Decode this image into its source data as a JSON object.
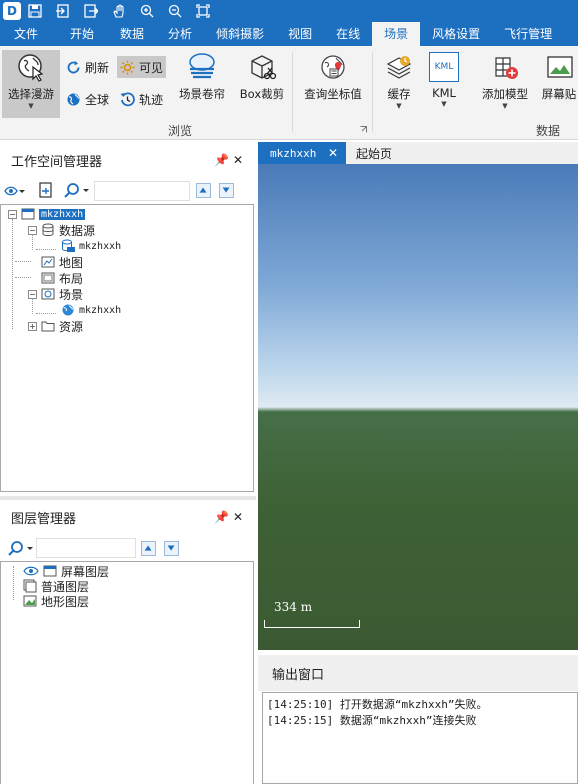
{
  "titlebar": {
    "logo_text": "D",
    "quick_access": [
      "save-icon",
      "import-icon",
      "export-icon",
      "pan-hand-icon",
      "zoom-in-icon",
      "zoom-out-icon",
      "full-extent-icon"
    ]
  },
  "menu": {
    "items": [
      "文件",
      "开始",
      "数据",
      "分析",
      "倾斜摄影",
      "视图",
      "在线",
      "场景",
      "风格设置",
      "飞行管理"
    ],
    "active_index": 7
  },
  "ribbon": {
    "browse": {
      "select_roam": "选择漫游",
      "refresh": "刷新",
      "visible": "可见",
      "globe": "全球",
      "track": "轨迹",
      "scene_curtain": "场景卷帘",
      "box_clip": "Box裁剪",
      "query_coords": "查询坐标值",
      "group_label": "浏览"
    },
    "data": {
      "cache": "缓存",
      "kml": "KML",
      "kml_icon_text": "KML",
      "add_model": "添加模型",
      "screen_paste": "屏幕贴",
      "group_label": "数据"
    }
  },
  "workspace": {
    "title": "工作空间管理器",
    "pin": "📌",
    "close": "✕",
    "tree": {
      "root": "mkzhxxh",
      "datasources": "数据源",
      "datasource_child": "mkzhxxh",
      "map": "地图",
      "layout": "布局",
      "scene": "场景",
      "scene_child": "mkzhxxh",
      "resources": "资源"
    }
  },
  "layers": {
    "title": "图层管理器",
    "pin": "📌",
    "close": "✕",
    "items": [
      "屏幕图层",
      "普通图层",
      "地形图层"
    ]
  },
  "document": {
    "tabs": [
      {
        "label": "mkzhxxh",
        "close": "✕"
      },
      {
        "label": "起始页"
      }
    ],
    "scale_text": "334  m"
  },
  "output": {
    "title": "输出窗口",
    "lines": [
      "[14:25:10] 打开数据源“mkzhxxh”失败。",
      "[14:25:15] 数据源“mkzhxxh”连接失败"
    ]
  },
  "colors": {
    "accent": "#1d6fc0",
    "ribbon_bg": "#f3f3f3",
    "selection": "#1d6fc0"
  }
}
